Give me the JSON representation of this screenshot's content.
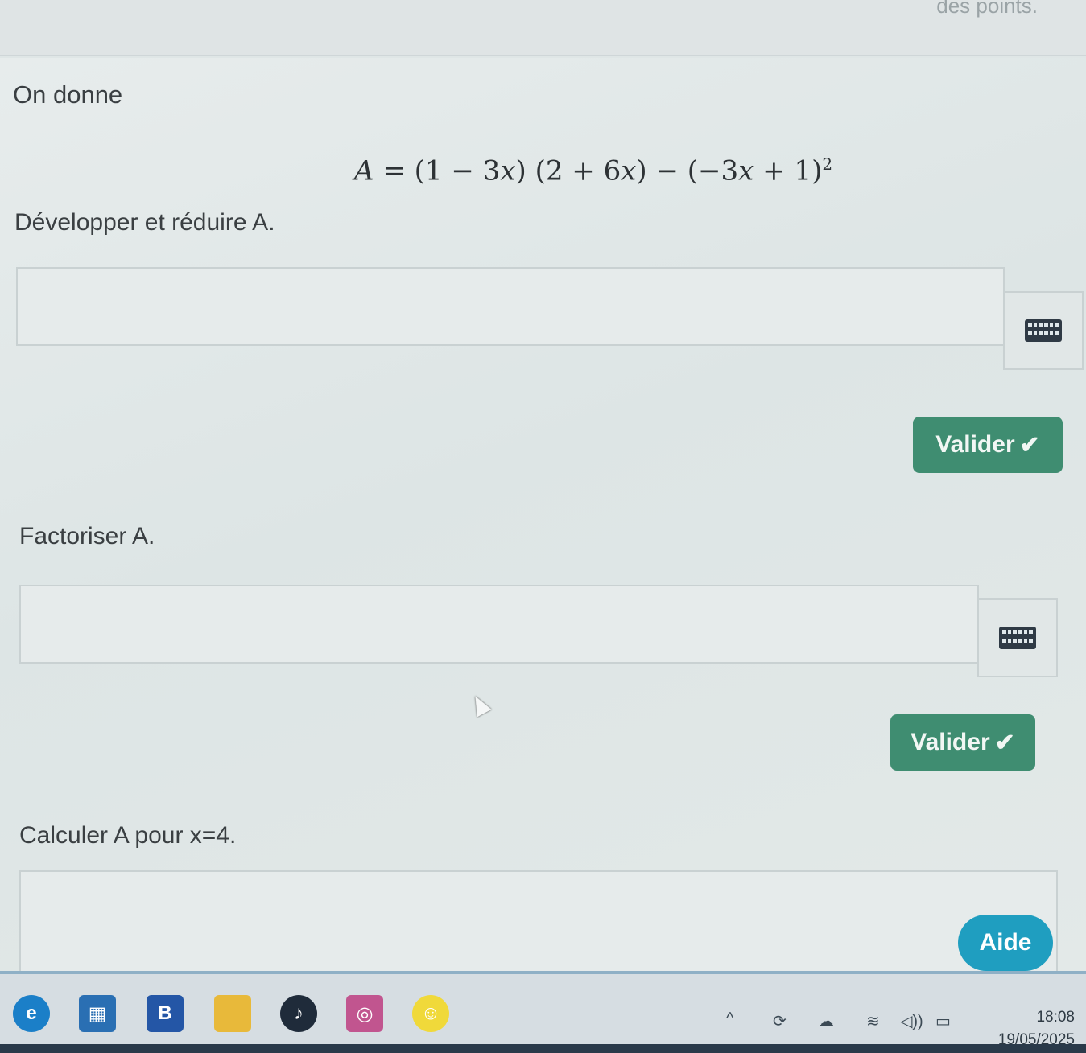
{
  "header": {
    "faint_text": "des points."
  },
  "exercise": {
    "intro": "On donne",
    "formula": {
      "lhs": "A",
      "eq": " = (1 − 3",
      "x1": "x",
      "part2": ") (2 + 6",
      "x2": "x",
      "part3": ") − (−3",
      "x3": "x",
      "part4": " + 1)",
      "exponent": "2"
    },
    "q1": {
      "label": "Développer et réduire A.",
      "validate_label": "Valider"
    },
    "q2": {
      "label": "Factoriser A.",
      "validate_label": "Valider"
    },
    "q3": {
      "label": "Calculer A pour x=4."
    },
    "help_label": "Aide",
    "check_glyph": "✔"
  },
  "taskbar": {
    "apps": [
      "edge-icon",
      "store-icon",
      "b-app-icon",
      "file-explorer-icon",
      "tiktok-icon",
      "instagram-icon",
      "snapchat-icon"
    ],
    "b_label": "B",
    "tray_chevron": "^",
    "tray_volume": "◁))",
    "time": "18:08",
    "date": "19/05/2025"
  },
  "colors": {
    "validate_bg": "#3f8d71",
    "help_bg": "#1f9ec0",
    "page_bg": "#dfe6e6"
  }
}
